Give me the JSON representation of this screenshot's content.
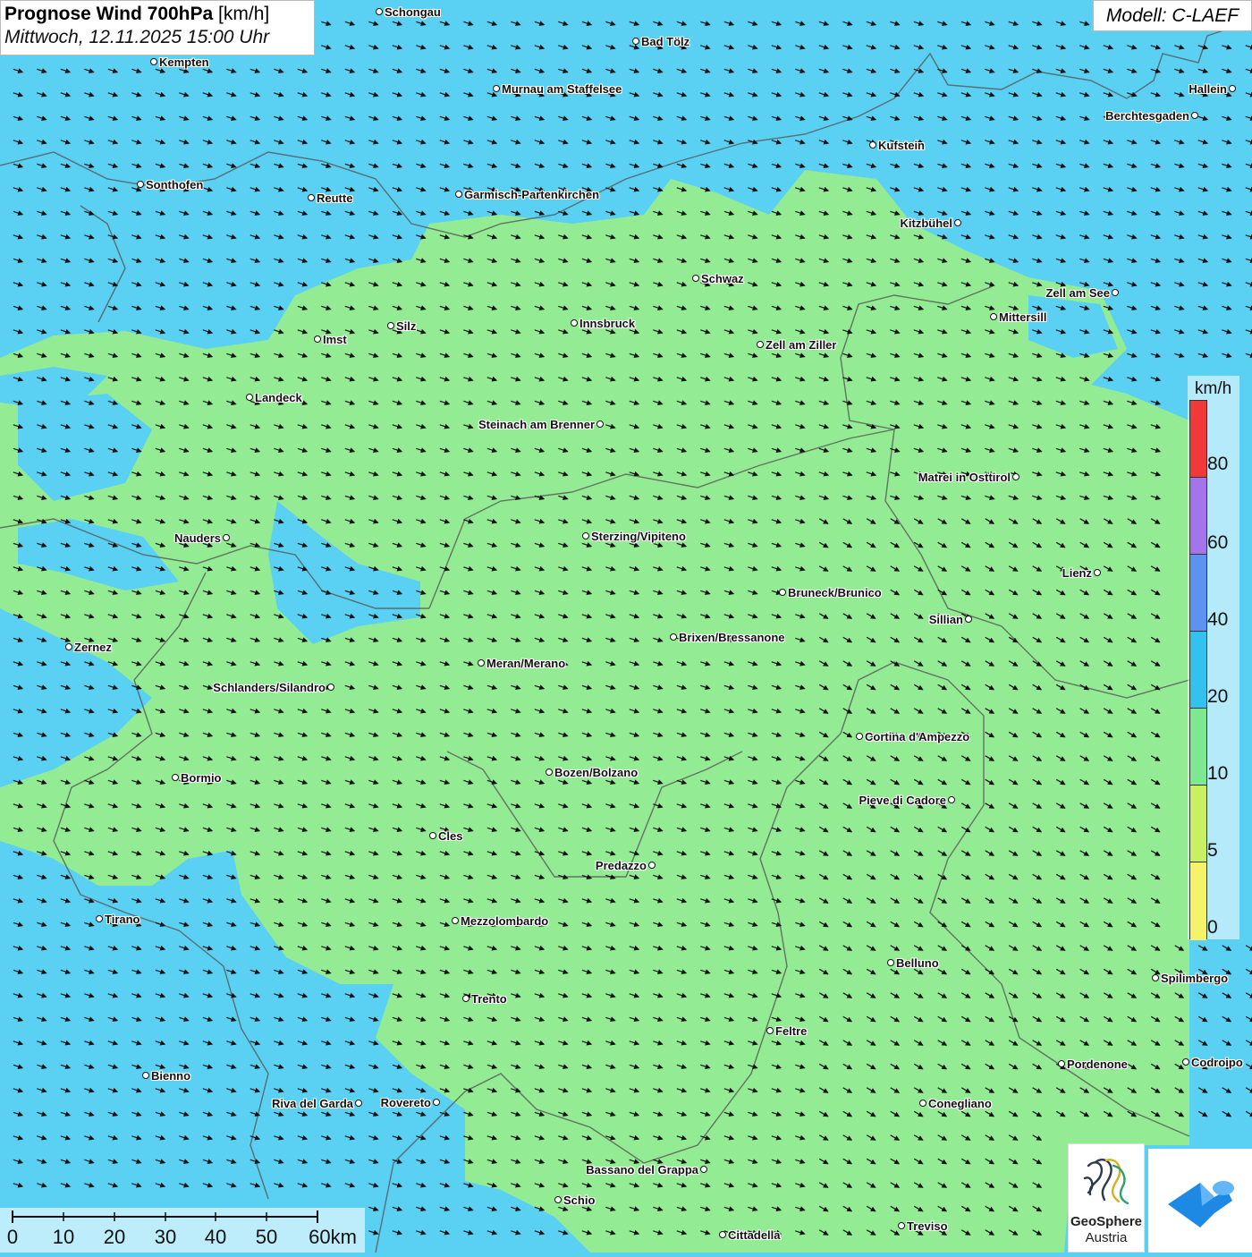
{
  "title": {
    "main_bold": "Prognose Wind 700hPa",
    "unit": "[km/h]",
    "datetime": "Mittwoch, 12.11.2025 15:00 Uhr"
  },
  "model": "Modell: C-LAEF",
  "legend": {
    "unit": "km/h",
    "ticks": [
      "80",
      "60",
      "40",
      "20",
      "10",
      "5",
      "0"
    ],
    "colors": [
      "#cfeef9",
      "#f03a3a",
      "#a374ec",
      "#5c93f0",
      "#33c1ef",
      "#7ee890",
      "#c8f061",
      "#f5f36a"
    ]
  },
  "wind": {
    "dominant_direction": "west-northwest",
    "arrow_icon": "wind-arrow-icon",
    "colors": {
      "weak": "#93ec93",
      "moderate": "#5ad0f3"
    }
  },
  "cities": [
    {
      "name": "Schongau"
    },
    {
      "name": "Kempten"
    },
    {
      "name": "Bad Tölz"
    },
    {
      "name": "Murnau am Staffelsee"
    },
    {
      "name": "Hallein"
    },
    {
      "name": "Berchtesgaden"
    },
    {
      "name": "Kufstein"
    },
    {
      "name": "Sonthofen"
    },
    {
      "name": "Reutte"
    },
    {
      "name": "Garmisch-Partenkirchen"
    },
    {
      "name": "Kitzbühel"
    },
    {
      "name": "Schwaz"
    },
    {
      "name": "Zell am See"
    },
    {
      "name": "Mittersill"
    },
    {
      "name": "Innsbruck"
    },
    {
      "name": "Silz"
    },
    {
      "name": "Imst"
    },
    {
      "name": "Zell am Ziller"
    },
    {
      "name": "Landeck"
    },
    {
      "name": "Steinach am Brenner"
    },
    {
      "name": "Matrei in Osttirol"
    },
    {
      "name": "Nauders"
    },
    {
      "name": "Sterzing/Vipiteno"
    },
    {
      "name": "Lienz"
    },
    {
      "name": "Bruneck/Brunico"
    },
    {
      "name": "Sillian"
    },
    {
      "name": "Brixen/Bressanone"
    },
    {
      "name": "Zernez"
    },
    {
      "name": "Meran/Merano"
    },
    {
      "name": "Schlanders/Silandro"
    },
    {
      "name": "Cortina d'Ampezzo"
    },
    {
      "name": "Bozen/Bolzano"
    },
    {
      "name": "Bormio"
    },
    {
      "name": "Pieve di Cadore"
    },
    {
      "name": "Cles"
    },
    {
      "name": "Predazzo"
    },
    {
      "name": "Tirano"
    },
    {
      "name": "Mezzolombardo"
    },
    {
      "name": "Belluno"
    },
    {
      "name": "Spilimbergo"
    },
    {
      "name": "Trento"
    },
    {
      "name": "Feltre"
    },
    {
      "name": "Pordenone"
    },
    {
      "name": "Codroipo"
    },
    {
      "name": "Bienno"
    },
    {
      "name": "Riva del Garda"
    },
    {
      "name": "Rovereto"
    },
    {
      "name": "Conegliano"
    },
    {
      "name": "Bassano del Grappa"
    },
    {
      "name": "Schio"
    },
    {
      "name": "Treviso"
    },
    {
      "name": "Cittadella"
    }
  ],
  "scale": {
    "labels": [
      "0",
      "10",
      "20",
      "30",
      "40",
      "50",
      "60km"
    ]
  },
  "logos": {
    "geosphere_line1": "GeoSphere",
    "geosphere_line2": "Austria",
    "brand_color": "#1e88e5"
  }
}
